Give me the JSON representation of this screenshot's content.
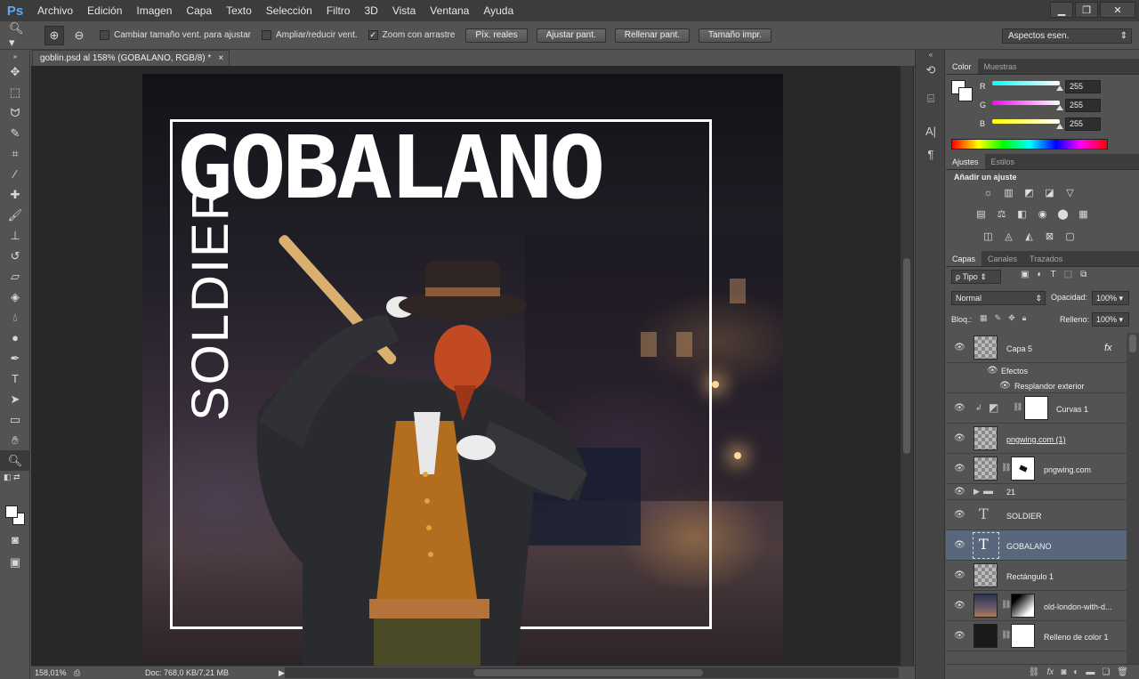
{
  "app": {
    "logo": "Ps"
  },
  "menu": [
    "Archivo",
    "Edición",
    "Imagen",
    "Capa",
    "Texto",
    "Selección",
    "Filtro",
    "3D",
    "Vista",
    "Ventana",
    "Ayuda"
  ],
  "options": {
    "cb_resize": "Cambiar tamaño vent. para ajustar",
    "cb_all": "Ampliar/reducir vent.",
    "cb_scrubby": "Zoom con arrastre",
    "btn_actual": "Píx. reales",
    "btn_fit": "Ajustar pant.",
    "btn_fill": "Rellenar pant.",
    "btn_print": "Tamaño impr.",
    "workspace": "Aspectos esen."
  },
  "document": {
    "tab_title": "goblin.psd al 158% (GOBALANO, RGB/8) *",
    "close": "×",
    "title_text": "GOBALANO",
    "soldier_text": "SOLDIER"
  },
  "status": {
    "zoom": "158,01%",
    "docsize": "Doc: 768,0 KB/7,21 MB"
  },
  "color_panel": {
    "tabs": [
      "Color",
      "Muestras"
    ],
    "r_label": "R",
    "r_value": "255",
    "g_label": "G",
    "g_value": "255",
    "b_label": "B",
    "b_value": "255"
  },
  "adjust_panel": {
    "tabs": [
      "Ajustes",
      "Estilos"
    ],
    "heading": "Añadir un ajuste"
  },
  "layers_panel": {
    "tabs": [
      "Capas",
      "Canales",
      "Trazados"
    ],
    "filter": "Tipo",
    "blend_mode": "Normal",
    "opacity_label": "Opacidad:",
    "opacity_value": "100%",
    "lock_label": "Bloq.:",
    "fill_label": "Relleno:",
    "fill_value": "100%",
    "layers": [
      {
        "name": "Capa 5",
        "fx": "fx"
      },
      {
        "name": "Efectos"
      },
      {
        "name": "Resplandor exterior"
      },
      {
        "name": "Curvas 1"
      },
      {
        "name": "pngwing.com (1)"
      },
      {
        "name": "pngwing.com"
      },
      {
        "name": "21"
      },
      {
        "name": "SOLDIER"
      },
      {
        "name": "GOBALANO"
      },
      {
        "name": "Rectángulo 1"
      },
      {
        "name": "old-london-with-d..."
      },
      {
        "name": "Relleno de color 1"
      }
    ]
  },
  "colors": {
    "selected_layer": "#58677c",
    "ps_blue": "#5aa8ff"
  }
}
